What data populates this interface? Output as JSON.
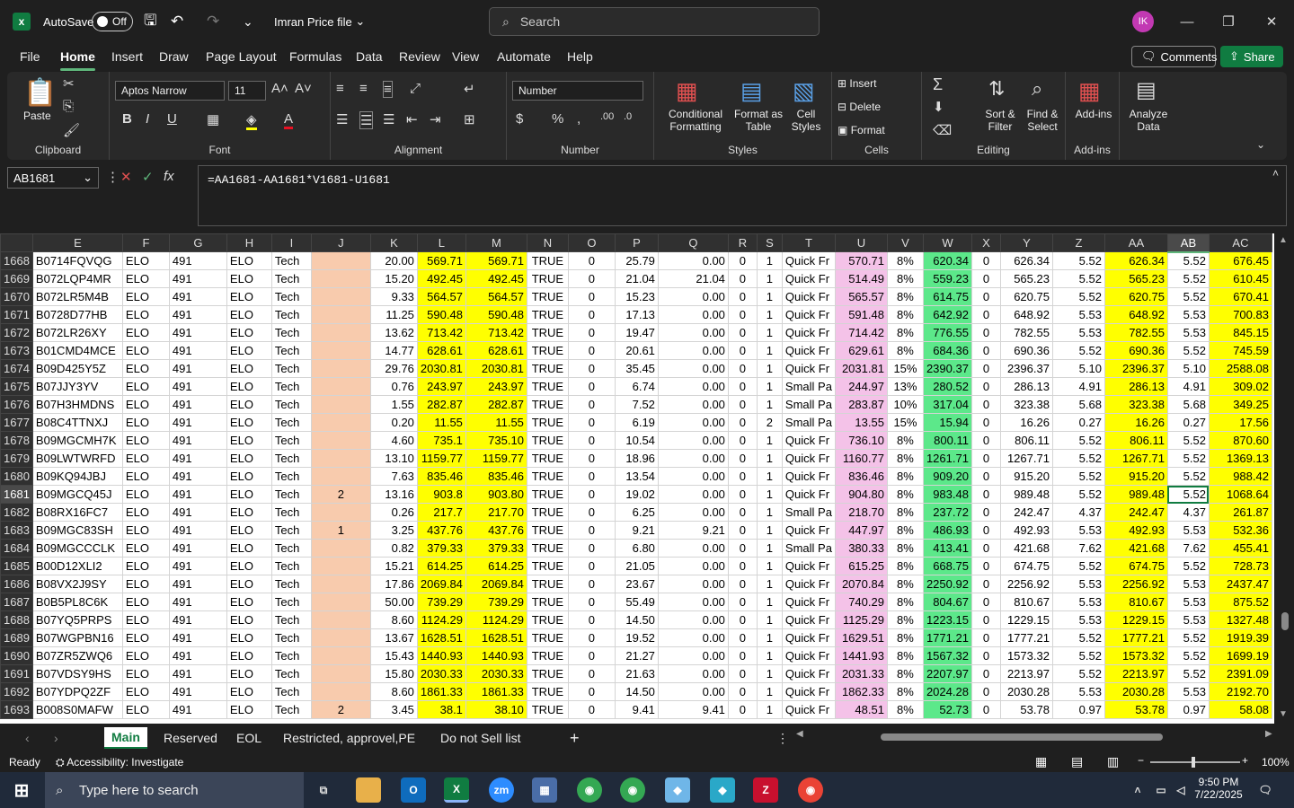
{
  "titlebar": {
    "autosave": "AutoSave",
    "toggle": "Off",
    "filename": "Imran Price file",
    "search_placeholder": "Search",
    "avatar": "IK"
  },
  "menus": [
    "File",
    "Home",
    "Insert",
    "Draw",
    "Page Layout",
    "Formulas",
    "Data",
    "Review",
    "View",
    "Automate",
    "Help"
  ],
  "menu_right": {
    "comments": "Comments",
    "share": "Share"
  },
  "ribbon": {
    "paste": "Paste",
    "clipboard": "Clipboard",
    "font_name": "Aptos Narrow",
    "font_size": "11",
    "font": "Font",
    "alignment": "Alignment",
    "number_format": "Number",
    "number": "Number",
    "conditional": "Conditional",
    "formatting": "Formatting",
    "format_as": "Format as",
    "table": "Table",
    "cell": "Cell",
    "styles_btn": "Styles",
    "styles": "Styles",
    "insert": "Insert",
    "delete": "Delete",
    "format": "Format",
    "cells": "Cells",
    "sort": "Sort &",
    "filter": "Filter",
    "find": "Find &",
    "select": "Select",
    "editing": "Editing",
    "addins_btn": "Add-ins",
    "addins": "Add-ins",
    "analyze": "Analyze",
    "data": "Data"
  },
  "formula_bar": {
    "namebox": "AB1681",
    "formula": "=AA1681-AA1681*V1681-U1681",
    "fx": "fx"
  },
  "columns": [
    "E",
    "F",
    "G",
    "H",
    "I",
    "J",
    "K",
    "L",
    "M",
    "N",
    "O",
    "P",
    "Q",
    "R",
    "S",
    "T",
    "U",
    "V",
    "W",
    "X",
    "Y",
    "Z",
    "AA",
    "AB",
    "AC"
  ],
  "rows": [
    [
      "1668",
      "B0714FQVQG",
      "ELO",
      "491",
      "ELO",
      "Tech",
      "",
      "20.00",
      "569.71",
      "569.71",
      "TRUE",
      "0",
      "25.79",
      "0.00",
      "0",
      "1",
      "Quick Fr",
      "570.71",
      "8%",
      "620.34",
      "0",
      "626.34",
      "5.52",
      "626.34",
      "5.52",
      "676.45"
    ],
    [
      "1669",
      "B072LQP4MR",
      "ELO",
      "491",
      "ELO",
      "Tech",
      "",
      "15.20",
      "492.45",
      "492.45",
      "TRUE",
      "0",
      "21.04",
      "21.04",
      "0",
      "1",
      "Quick Fr",
      "514.49",
      "8%",
      "559.23",
      "0",
      "565.23",
      "5.52",
      "565.23",
      "5.52",
      "610.45"
    ],
    [
      "1670",
      "B072LR5M4B",
      "ELO",
      "491",
      "ELO",
      "Tech",
      "",
      "9.33",
      "564.57",
      "564.57",
      "TRUE",
      "0",
      "15.23",
      "0.00",
      "0",
      "1",
      "Quick Fr",
      "565.57",
      "8%",
      "614.75",
      "0",
      "620.75",
      "5.52",
      "620.75",
      "5.52",
      "670.41"
    ],
    [
      "1671",
      "B0728D77HB",
      "ELO",
      "491",
      "ELO",
      "Tech",
      "",
      "11.25",
      "590.48",
      "590.48",
      "TRUE",
      "0",
      "17.13",
      "0.00",
      "0",
      "1",
      "Quick Fr",
      "591.48",
      "8%",
      "642.92",
      "0",
      "648.92",
      "5.53",
      "648.92",
      "5.53",
      "700.83"
    ],
    [
      "1672",
      "B072LR26XY",
      "ELO",
      "491",
      "ELO",
      "Tech",
      "",
      "13.62",
      "713.42",
      "713.42",
      "TRUE",
      "0",
      "19.47",
      "0.00",
      "0",
      "1",
      "Quick Fr",
      "714.42",
      "8%",
      "776.55",
      "0",
      "782.55",
      "5.53",
      "782.55",
      "5.53",
      "845.15"
    ],
    [
      "1673",
      "B01CMD4MCE",
      "ELO",
      "491",
      "ELO",
      "Tech",
      "",
      "14.77",
      "628.61",
      "628.61",
      "TRUE",
      "0",
      "20.61",
      "0.00",
      "0",
      "1",
      "Quick Fr",
      "629.61",
      "8%",
      "684.36",
      "0",
      "690.36",
      "5.52",
      "690.36",
      "5.52",
      "745.59"
    ],
    [
      "1674",
      "B09D425Y5Z",
      "ELO",
      "491",
      "ELO",
      "Tech",
      "",
      "29.76",
      "2030.81",
      "2030.81",
      "TRUE",
      "0",
      "35.45",
      "0.00",
      "0",
      "1",
      "Quick Fr",
      "2031.81",
      "15%",
      "2390.37",
      "0",
      "2396.37",
      "5.10",
      "2396.37",
      "5.10",
      "2588.08"
    ],
    [
      "1675",
      "B07JJY3YV",
      "ELO",
      "491",
      "ELO",
      "Tech",
      "",
      "0.76",
      "243.97",
      "243.97",
      "TRUE",
      "0",
      "6.74",
      "0.00",
      "0",
      "1",
      "Small Pa",
      "244.97",
      "13%",
      "280.52",
      "0",
      "286.13",
      "4.91",
      "286.13",
      "4.91",
      "309.02"
    ],
    [
      "1676",
      "B07H3HMDNS",
      "ELO",
      "491",
      "ELO",
      "Tech",
      "",
      "1.55",
      "282.87",
      "282.87",
      "TRUE",
      "0",
      "7.52",
      "0.00",
      "0",
      "1",
      "Small Pa",
      "283.87",
      "10%",
      "317.04",
      "0",
      "323.38",
      "5.68",
      "323.38",
      "5.68",
      "349.25"
    ],
    [
      "1677",
      "B08C4TTNXJ",
      "ELO",
      "491",
      "ELO",
      "Tech",
      "",
      "0.20",
      "11.55",
      "11.55",
      "TRUE",
      "0",
      "6.19",
      "0.00",
      "0",
      "2",
      "Small Pa",
      "13.55",
      "15%",
      "15.94",
      "0",
      "16.26",
      "0.27",
      "16.26",
      "0.27",
      "17.56"
    ],
    [
      "1678",
      "B09MGCMH7K",
      "ELO",
      "491",
      "ELO",
      "Tech",
      "",
      "4.60",
      "735.1",
      "735.10",
      "TRUE",
      "0",
      "10.54",
      "0.00",
      "0",
      "1",
      "Quick Fr",
      "736.10",
      "8%",
      "800.11",
      "0",
      "806.11",
      "5.52",
      "806.11",
      "5.52",
      "870.60"
    ],
    [
      "1679",
      "B09LWTWRFD",
      "ELO",
      "491",
      "ELO",
      "Tech",
      "",
      "13.10",
      "1159.77",
      "1159.77",
      "TRUE",
      "0",
      "18.96",
      "0.00",
      "0",
      "1",
      "Quick Fr",
      "1160.77",
      "8%",
      "1261.71",
      "0",
      "1267.71",
      "5.52",
      "1267.71",
      "5.52",
      "1369.13"
    ],
    [
      "1680",
      "B09KQ94JBJ",
      "ELO",
      "491",
      "ELO",
      "Tech",
      "",
      "7.63",
      "835.46",
      "835.46",
      "TRUE",
      "0",
      "13.54",
      "0.00",
      "0",
      "1",
      "Quick Fr",
      "836.46",
      "8%",
      "909.20",
      "0",
      "915.20",
      "5.52",
      "915.20",
      "5.52",
      "988.42"
    ],
    [
      "1681",
      "B09MGCQ45J",
      "ELO",
      "491",
      "ELO",
      "Tech",
      "2",
      "13.16",
      "903.8",
      "903.80",
      "TRUE",
      "0",
      "19.02",
      "0.00",
      "0",
      "1",
      "Quick Fr",
      "904.80",
      "8%",
      "983.48",
      "0",
      "989.48",
      "5.52",
      "989.48",
      "5.52",
      "1068.64"
    ],
    [
      "1682",
      "B08RX16FC7",
      "ELO",
      "491",
      "ELO",
      "Tech",
      "",
      "0.26",
      "217.7",
      "217.70",
      "TRUE",
      "0",
      "6.25",
      "0.00",
      "0",
      "1",
      "Small Pa",
      "218.70",
      "8%",
      "237.72",
      "0",
      "242.47",
      "4.37",
      "242.47",
      "4.37",
      "261.87"
    ],
    [
      "1683",
      "B09MGC83SH",
      "ELO",
      "491",
      "ELO",
      "Tech",
      "1",
      "3.25",
      "437.76",
      "437.76",
      "TRUE",
      "0",
      "9.21",
      "9.21",
      "0",
      "1",
      "Quick Fr",
      "447.97",
      "8%",
      "486.93",
      "0",
      "492.93",
      "5.53",
      "492.93",
      "5.53",
      "532.36"
    ],
    [
      "1684",
      "B09MGCCCLK",
      "ELO",
      "491",
      "ELO",
      "Tech",
      "",
      "0.82",
      "379.33",
      "379.33",
      "TRUE",
      "0",
      "6.80",
      "0.00",
      "0",
      "1",
      "Small Pa",
      "380.33",
      "8%",
      "413.41",
      "0",
      "421.68",
      "7.62",
      "421.68",
      "7.62",
      "455.41"
    ],
    [
      "1685",
      "B00D12XLI2",
      "ELO",
      "491",
      "ELO",
      "Tech",
      "",
      "15.21",
      "614.25",
      "614.25",
      "TRUE",
      "0",
      "21.05",
      "0.00",
      "0",
      "1",
      "Quick Fr",
      "615.25",
      "8%",
      "668.75",
      "0",
      "674.75",
      "5.52",
      "674.75",
      "5.52",
      "728.73"
    ],
    [
      "1686",
      "B08VX2J9SY",
      "ELO",
      "491",
      "ELO",
      "Tech",
      "",
      "17.86",
      "2069.84",
      "2069.84",
      "TRUE",
      "0",
      "23.67",
      "0.00",
      "0",
      "1",
      "Quick Fr",
      "2070.84",
      "8%",
      "2250.92",
      "0",
      "2256.92",
      "5.53",
      "2256.92",
      "5.53",
      "2437.47"
    ],
    [
      "1687",
      "B0B5PL8C6K",
      "ELO",
      "491",
      "ELO",
      "Tech",
      "",
      "50.00",
      "739.29",
      "739.29",
      "TRUE",
      "0",
      "55.49",
      "0.00",
      "0",
      "1",
      "Quick Fr",
      "740.29",
      "8%",
      "804.67",
      "0",
      "810.67",
      "5.53",
      "810.67",
      "5.53",
      "875.52"
    ],
    [
      "1688",
      "B07YQ5PRPS",
      "ELO",
      "491",
      "ELO",
      "Tech",
      "",
      "8.60",
      "1124.29",
      "1124.29",
      "TRUE",
      "0",
      "14.50",
      "0.00",
      "0",
      "1",
      "Quick Fr",
      "1125.29",
      "8%",
      "1223.15",
      "0",
      "1229.15",
      "5.53",
      "1229.15",
      "5.53",
      "1327.48"
    ],
    [
      "1689",
      "B07WGPBN16",
      "ELO",
      "491",
      "ELO",
      "Tech",
      "",
      "13.67",
      "1628.51",
      "1628.51",
      "TRUE",
      "0",
      "19.52",
      "0.00",
      "0",
      "1",
      "Quick Fr",
      "1629.51",
      "8%",
      "1771.21",
      "0",
      "1777.21",
      "5.52",
      "1777.21",
      "5.52",
      "1919.39"
    ],
    [
      "1690",
      "B07ZR5ZWQ6",
      "ELO",
      "491",
      "ELO",
      "Tech",
      "",
      "15.43",
      "1440.93",
      "1440.93",
      "TRUE",
      "0",
      "21.27",
      "0.00",
      "0",
      "1",
      "Quick Fr",
      "1441.93",
      "8%",
      "1567.32",
      "0",
      "1573.32",
      "5.52",
      "1573.32",
      "5.52",
      "1699.19"
    ],
    [
      "1691",
      "B07VDSY9HS",
      "ELO",
      "491",
      "ELO",
      "Tech",
      "",
      "15.80",
      "2030.33",
      "2030.33",
      "TRUE",
      "0",
      "21.63",
      "0.00",
      "0",
      "1",
      "Quick Fr",
      "2031.33",
      "8%",
      "2207.97",
      "0",
      "2213.97",
      "5.52",
      "2213.97",
      "5.52",
      "2391.09"
    ],
    [
      "1692",
      "B07YDPQ2ZF",
      "ELO",
      "491",
      "ELO",
      "Tech",
      "",
      "8.60",
      "1861.33",
      "1861.33",
      "TRUE",
      "0",
      "14.50",
      "0.00",
      "0",
      "1",
      "Quick Fr",
      "1862.33",
      "8%",
      "2024.28",
      "0",
      "2030.28",
      "5.53",
      "2030.28",
      "5.53",
      "2192.70"
    ],
    [
      "1693",
      "B008S0MAFW",
      "ELO",
      "491",
      "ELO",
      "Tech",
      "2",
      "3.45",
      "38.1",
      "38.10",
      "TRUE",
      "0",
      "9.41",
      "9.41",
      "0",
      "1",
      "Quick Fr",
      "48.51",
      "8%",
      "52.73",
      "0",
      "53.78",
      "0.97",
      "53.78",
      "0.97",
      "58.08"
    ]
  ],
  "sheets": [
    "Main",
    "Reserved",
    "EOL",
    "Restricted, approvel,PE",
    "Do not Sell list"
  ],
  "status": {
    "ready": "Ready",
    "accessibility": "Accessibility: Investigate",
    "zoom": "100%"
  },
  "taskbar": {
    "search_placeholder": "Type here to search",
    "time": "9:50 PM",
    "date": "7/22/2025"
  },
  "colors": {
    "yellow": "#ffff00",
    "peach": "#f8cbad",
    "pink": "#f4c2e8",
    "green": "#5ce88a",
    "excel_green": "#107c41"
  }
}
